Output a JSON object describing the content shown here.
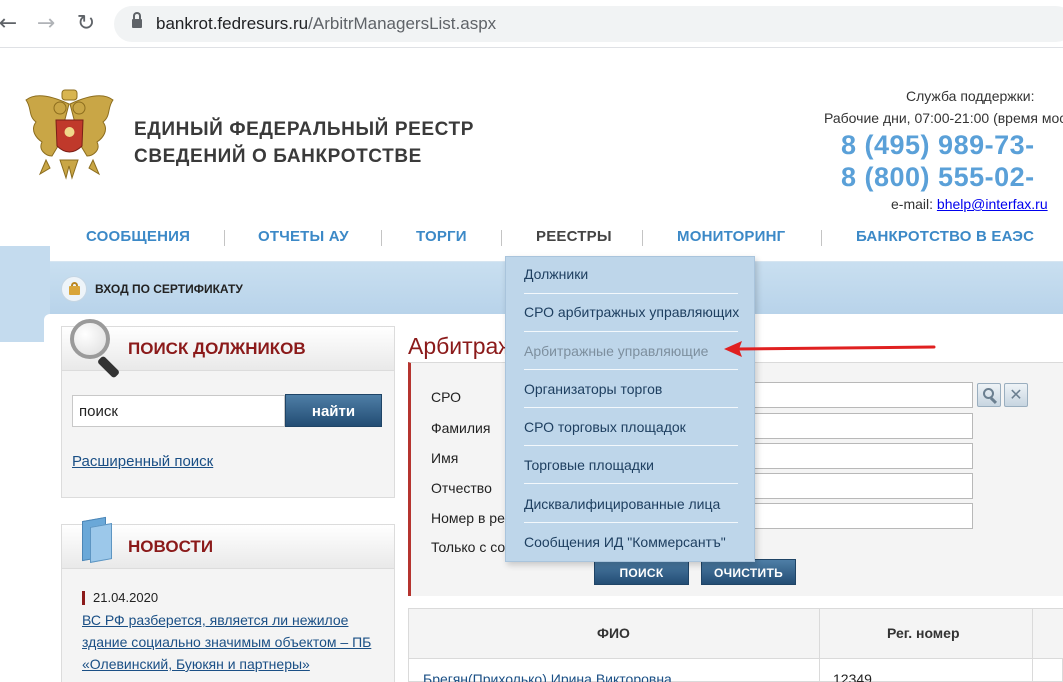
{
  "browser": {
    "back_icon": "←",
    "forward_icon": "→",
    "reload_icon": "↻",
    "url_host": "bankrot.fedresurs.ru",
    "url_path": "/ArbitrManagersList.aspx"
  },
  "header": {
    "title_line1": "ЕДИНЫЙ ФЕДЕРАЛЬНЫЙ РЕЕСТР",
    "title_line2": "СВЕДЕНИЙ О БАНКРОТСТВЕ",
    "support_label": "Служба поддержки:",
    "support_hours": "Рабочие дни, 07:00-21:00 (время моск",
    "phone1": "8 (495) 989-73-",
    "phone2": "8 (800) 555-02-",
    "email_label": "e-mail:",
    "email": "bhelp@interfax.ru"
  },
  "menu": {
    "items": [
      {
        "label": "СООБЩЕНИЯ"
      },
      {
        "label": "ОТЧЕТЫ АУ"
      },
      {
        "label": "ТОРГИ"
      },
      {
        "label": "РЕЕСТРЫ"
      },
      {
        "label": "МОНИТОРИНГ"
      },
      {
        "label": "БАНКРОТСТВО В ЕАЭС"
      }
    ]
  },
  "certificate": {
    "label": "ВХОД ПО СЕРТИФИКАТУ"
  },
  "search_box": {
    "title": "ПОИСК ДОЛЖНИКОВ",
    "input_value": "поиск",
    "button": "найти",
    "advanced_link": "Расширенный поиск"
  },
  "news_box": {
    "title": "НОВОСТИ",
    "date": "21.04.2020",
    "text": "ВС РФ разберется, является ли нежилое здание социально значимым объектом – ПБ «Олевинский, Буюкян и партнеры»"
  },
  "main": {
    "title": "Арбитраж",
    "form": {
      "labels": [
        "СРО",
        "Фамилия",
        "Имя",
        "Отчество",
        "Номер в ре",
        "Только с со"
      ],
      "search_button": "ПОИСК",
      "clear_button": "ОЧИСТИТЬ",
      "clear_icon": "✕"
    },
    "table": {
      "headers": [
        "ФИО",
        "Рег. номер"
      ],
      "rows": [
        {
          "name": "Брегян(Прихолько) Ирина Викторовна",
          "reg": "12349"
        }
      ]
    }
  },
  "dropdown": {
    "items": [
      {
        "label": "Должники"
      },
      {
        "label": "СРО арбитражных управляющих"
      },
      {
        "label": "Арбитражные управляющие"
      },
      {
        "label": "Организаторы торгов"
      },
      {
        "label": "СРО торговых площадок"
      },
      {
        "label": "Торговые площадки"
      },
      {
        "label": "Дисквалифицированные лица"
      },
      {
        "label": "Сообщения ИД \"Коммерсантъ\""
      }
    ]
  },
  "colors": {
    "accent_blue": "#3c89c7",
    "phone_blue": "#5aa0d8",
    "heading_red": "#8b1a1a",
    "arrow_red": "#e02020"
  }
}
